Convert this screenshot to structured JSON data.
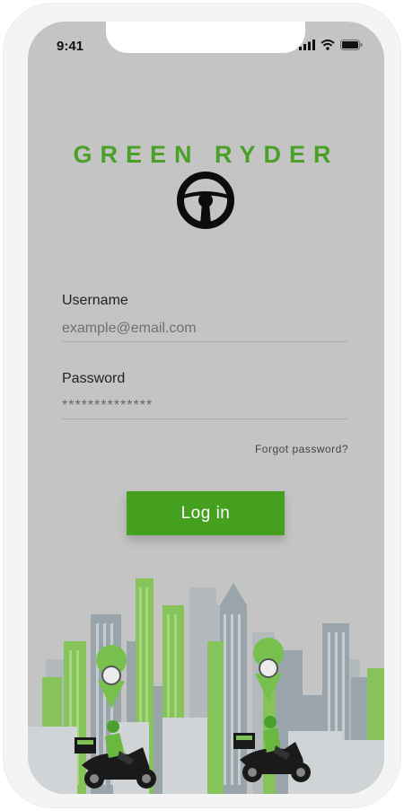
{
  "status_bar": {
    "time": "9:41"
  },
  "app": {
    "title": "GREEN RYDER"
  },
  "form": {
    "username_label": "Username",
    "username_placeholder": "example@email.com",
    "password_label": "Password",
    "password_value": "**************",
    "forgot_password": "Forgot password?",
    "login_button": "Log in"
  },
  "colors": {
    "brand_green": "#46a01f",
    "screen_bg": "#c4c4c4"
  },
  "icons": [
    "signal-icon",
    "wifi-icon",
    "battery-icon",
    "steering-wheel-icon",
    "location-pin-icon",
    "scooter-icon"
  ]
}
